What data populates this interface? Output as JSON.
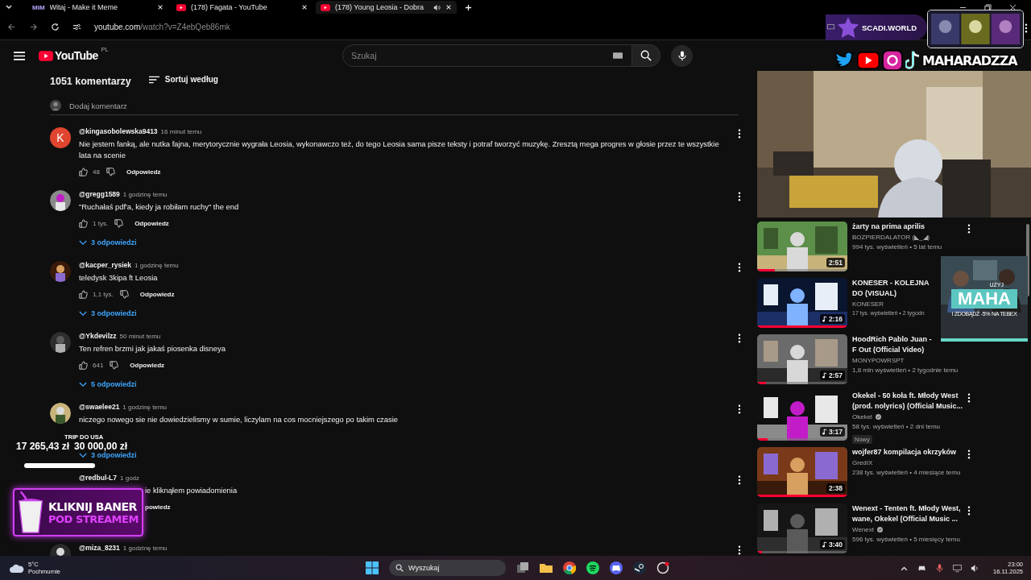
{
  "browser": {
    "tabs": [
      {
        "kind": "meme",
        "icon_text": "MIM",
        "title": "Witaj - Make it Meme",
        "audio": false,
        "selected": false
      },
      {
        "kind": "youtube",
        "title": "(178) Fagata - YouTube",
        "audio": false,
        "selected": false
      },
      {
        "kind": "youtube",
        "title": "(178) Young Leosia - Dobra",
        "audio": true,
        "selected": true
      }
    ],
    "url": {
      "host": "youtube.com",
      "path": "/watch?v=Z4ebQeb86mk"
    }
  },
  "youtube": {
    "logo": "YouTube",
    "region": "PL",
    "search": {
      "placeholder": "Szukaj"
    }
  },
  "comments": {
    "count": "1051 komentarzy",
    "sort": "Sortuj według",
    "add_placeholder": "Dodaj komentarz",
    "items": [
      {
        "kind": "full",
        "avatar": {
          "kind": "letter",
          "letter": "K",
          "color": "#e0452f"
        },
        "author": "@kingasobolewska9413",
        "time": "16 minut temu",
        "text": "Nie jestem fanką, ale nutka fajna, merytorycznie wygrała Leosia, wykonawczo też, do tego Leosia sama pisze teksty i potraf tworzyć muzykę. Zresztą mega progres w głosie przez te wszystkie lata na scenie",
        "likes": "48",
        "reply": "Odpowiedz"
      },
      {
        "kind": "full",
        "author": "@gregg1589",
        "time": "1 godzinę temu",
        "text": "\"Ruchałaś pdf'a, kiedy ja robiłam ruchy\" the end",
        "likes": "1 tys.",
        "reply": "Odpowiedz",
        "replies": "3 odpowiedzi"
      },
      {
        "kind": "full",
        "author": "@kacper_rysiek",
        "time": "1 godzinę temu",
        "text": "teledysk 3kipa ft Leosia",
        "likes": "1,1 tys.",
        "reply": "Odpowiedz",
        "replies": "3 odpowiedzi"
      },
      {
        "kind": "full",
        "author": "@Ykdevilzz",
        "time": "50 minut temu",
        "text": "Ten refren brzmi jak jakaś piosenka disneya",
        "likes": "641",
        "reply": "Odpowiedz",
        "replies": "5 odpowiedzi"
      },
      {
        "kind": "full",
        "author": "@swaelee21",
        "time": "1 godzinę temu",
        "text": "niczego nowego sie nie dowiedzielismy w sumie, liczylam na cos mocniejszego po takim czasie",
        "replies": "3 odpowiedzi"
      },
      {
        "kind": "covered",
        "author": "@redbul-L7",
        "time": "1 godz",
        "text": "ie kliknąłem powiadomienia",
        "reply": "powiedz"
      },
      {
        "kind": "full",
        "author": "@miza_8231",
        "time": "1 godzinę temu"
      }
    ]
  },
  "videos": [
    {
      "title": "żarty na prima aprilis",
      "channel": "BOZPIERDALATOR (◣_◢)",
      "verified": false,
      "meta": "994 tys. wyświetleń • 5 lat temu",
      "duration": "2:51",
      "music": false,
      "level": 0.2
    },
    {
      "title": "KONESER - KOLEJNA DO (VISUAL)",
      "channel": "KONESER",
      "verified": false,
      "meta": "17 tys. wyświetleń • 2 tygodn",
      "duration": "2:16",
      "music": true,
      "level": 1
    },
    {
      "title": "HoodRich Pablo Juan - F Out (Official Video)",
      "channel": "MONYPOWRSPT",
      "verified": false,
      "meta": "1,8 mln wyświetleń • 2 tygodnie temu",
      "duration": "2:57",
      "music": true,
      "level": 0.1
    },
    {
      "title": "Okekel - 50 koła ft. Młody West (prod. nolyrics) (Official Music...",
      "channel": "Okekel",
      "verified": true,
      "meta": "58 tys. wyświetleń • 2 dni temu",
      "badge": "Nowy",
      "duration": "3:17",
      "music": true,
      "level": 0.12
    },
    {
      "title": "wojfer87 kompilacja okrzyków",
      "channel": "GredIX",
      "verified": false,
      "meta": "238 tys. wyświetleń • 4 miesiące temu",
      "duration": "2:38",
      "music": false,
      "level": 1
    },
    {
      "title": "Wenext - Tenten ft. Młody West, wane, Okekel (Official Music ...",
      "channel": "Wenext",
      "verified": true,
      "meta": "596 tys. wyświetleń • 5 miesięcy temu",
      "duration": "3:40",
      "music": true,
      "level": 0.05
    }
  ],
  "stream_overlay": {
    "sponsor": "SCADI.WORLD",
    "social_handle": "MAHARADZZA",
    "promo": {
      "top": "UŻYJ",
      "code": "MAHA",
      "bottom": "I ZDOBĄDŹ -5% NA TEBEX"
    },
    "goal": {
      "title": "TRIP DO USA",
      "current": "17 265,43 zł",
      "target": "30 000,00 zł",
      "level": 0.58
    },
    "banner": {
      "line1": "KLIKNIJ BANER",
      "line2": "POD STREAMEM"
    }
  },
  "taskbar": {
    "weather": {
      "temp": "5°C",
      "desc": "Pochmurnie"
    },
    "search": {
      "placeholder": "Wyszukaj"
    },
    "time": "23:00",
    "date": "16.11.2025"
  }
}
